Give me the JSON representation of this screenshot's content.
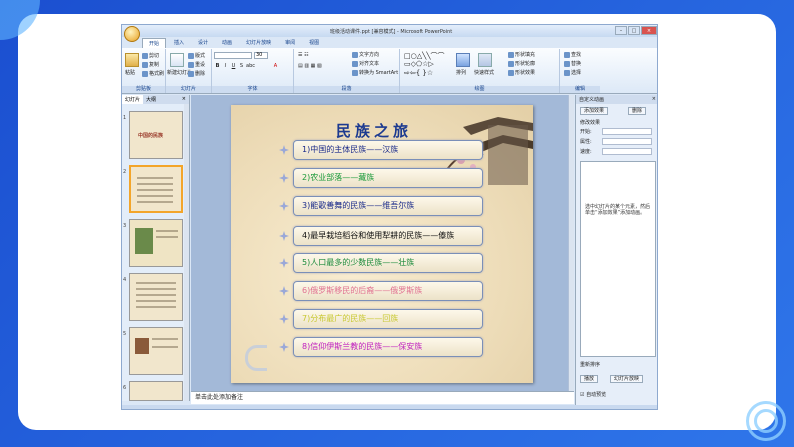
{
  "window": {
    "title": "班级活动课件.ppt [兼容模式] - Microsoft PowerPoint",
    "controls": [
      "–",
      "□",
      "×"
    ]
  },
  "ribbon": {
    "tabs": [
      "开始",
      "插入",
      "设计",
      "动画",
      "幻灯片放映",
      "审阅",
      "视图"
    ],
    "groups": [
      "剪贴板",
      "幻灯片",
      "字体",
      "段落",
      "绘图",
      "编辑"
    ],
    "clipboard": {
      "paste": "粘贴",
      "cut": "剪切",
      "copy": "复制",
      "format_painter": "格式刷"
    },
    "slides": {
      "new_slide": "新建幻灯片",
      "layout": "版式",
      "reset": "重设",
      "delete": "删除"
    },
    "paragraph": {
      "text_direction": "文字方向",
      "align_text": "对齐文本",
      "smartart": "转换为 SmartArt"
    },
    "drawing": {
      "arrange": "排列",
      "quick_styles": "快速样式",
      "shape_fill": "形状填充",
      "shape_outline": "形状轮廓",
      "shape_effects": "形状效果"
    },
    "editing": {
      "find": "查找",
      "replace": "替换",
      "select": "选择"
    },
    "font_size": "30"
  },
  "left_panel": {
    "tabs": [
      "幻灯片",
      "大纲"
    ],
    "close": "×",
    "thumbnails": [
      {
        "num": "1",
        "title": "中国的民族"
      },
      {
        "num": "2",
        "title": ""
      },
      {
        "num": "3",
        "title": ""
      },
      {
        "num": "4",
        "title": ""
      },
      {
        "num": "5",
        "title": ""
      },
      {
        "num": "6",
        "title": ""
      }
    ]
  },
  "slide": {
    "title": "民族之旅",
    "items": [
      {
        "text": "1)中国的主体民族——汉族",
        "color": "#1a2a8a"
      },
      {
        "text": "2)农业部落——藏族",
        "color": "#1a9a3a"
      },
      {
        "text": "3)能歌善舞的民族——维吾尔族",
        "color": "#1a2a8a"
      },
      {
        "text": "4)最早栽培稻谷和使用犁耕的民族——傣族",
        "color": "#111111"
      },
      {
        "text": "5)人口最多的少数民族——壮族",
        "color": "#1a8a3a"
      },
      {
        "text": "6)俄罗斯移民的后裔——俄罗斯族",
        "color": "#e07090"
      },
      {
        "text": "7)分布最广的民族——回族",
        "color": "#c8c830"
      },
      {
        "text": "8)信仰伊斯兰教的民族——保安族",
        "color": "#c020c0"
      }
    ]
  },
  "notes": {
    "placeholder": "单击此处添加备注"
  },
  "right_panel": {
    "title": "自定义动画",
    "close": "×",
    "add_effect": "添加效果",
    "remove": "删除",
    "modify": "修改效果",
    "fields": [
      "开始:",
      "属性:",
      "速度:"
    ],
    "hint": "选中幻灯片的某个元素，然后单击“添加效果”添加动画。",
    "reorder_label": "重新排序",
    "play": "播放",
    "slideshow": "幻灯片放映",
    "autopreview": "自动预览"
  }
}
